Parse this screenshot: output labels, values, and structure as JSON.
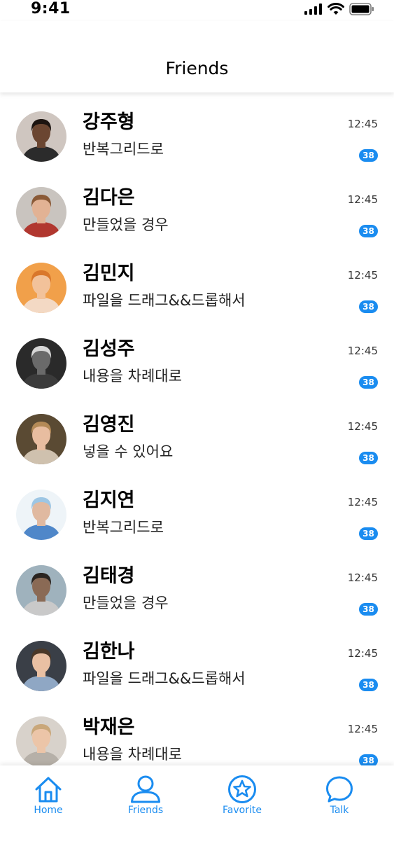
{
  "status": {
    "time": "9:41"
  },
  "header": {
    "title": "Friends"
  },
  "friends": [
    {
      "name": "강주형",
      "message": "반복그리드로",
      "time": "12:45",
      "badge": "38",
      "skin": "#6b4631",
      "hair": "#1c1410",
      "bg": "#cfc6c0",
      "shirt": "#2b2b2b"
    },
    {
      "name": "김다은",
      "message": "만들었을 경우",
      "time": "12:45",
      "badge": "38",
      "skin": "#e2b294",
      "hair": "#8a5a37",
      "bg": "#c9c4bf",
      "shirt": "#b1372f"
    },
    {
      "name": "김민지",
      "message": "파일을 드래그&&드롭해서",
      "time": "12:45",
      "badge": "38",
      "skin": "#f2c29a",
      "hair": "#d9772b",
      "bg": "#f1a04a",
      "shirt": "#f3d9c4"
    },
    {
      "name": "김성주",
      "message": "내용을 차례대로",
      "time": "12:45",
      "badge": "38",
      "skin": "#6a6a6a",
      "hair": "#d6d6d6",
      "bg": "#2a2a2a",
      "shirt": "#3b3b3b"
    },
    {
      "name": "김영진",
      "message": "넣을 수 있어요",
      "time": "12:45",
      "badge": "38",
      "skin": "#e8bda0",
      "hair": "#b48a57",
      "bg": "#5a4a33",
      "shirt": "#cfc1ae"
    },
    {
      "name": "김지연",
      "message": "반복그리드로",
      "time": "12:45",
      "badge": "38",
      "skin": "#e0b9a0",
      "hair": "#9dc6e4",
      "bg": "#eef4f8",
      "shirt": "#4f87c9"
    },
    {
      "name": "김태경",
      "message": "만들었을 경우",
      "time": "12:45",
      "badge": "38",
      "skin": "#8a6a55",
      "hair": "#2a2420",
      "bg": "#9fb2bd",
      "shirt": "#c9c9c9"
    },
    {
      "name": "김한나",
      "message": "파일을 드래그&&드롭해서",
      "time": "12:45",
      "badge": "38",
      "skin": "#e9c0a3",
      "hair": "#4a3828",
      "bg": "#3a3f47",
      "shirt": "#8fa7c4"
    },
    {
      "name": "박재은",
      "message": "내용을 차례대로",
      "time": "12:45",
      "badge": "38",
      "skin": "#ecc5a8",
      "hair": "#c9a77a",
      "bg": "#d8d2cb",
      "shirt": "#b6b0a8"
    }
  ],
  "tabs": [
    {
      "label": "Home",
      "icon": "home-icon"
    },
    {
      "label": "Friends",
      "icon": "person-icon"
    },
    {
      "label": "Favorite",
      "icon": "star-icon"
    },
    {
      "label": "Talk",
      "icon": "chat-bubble-icon"
    }
  ],
  "accent": "#1a8cf0"
}
